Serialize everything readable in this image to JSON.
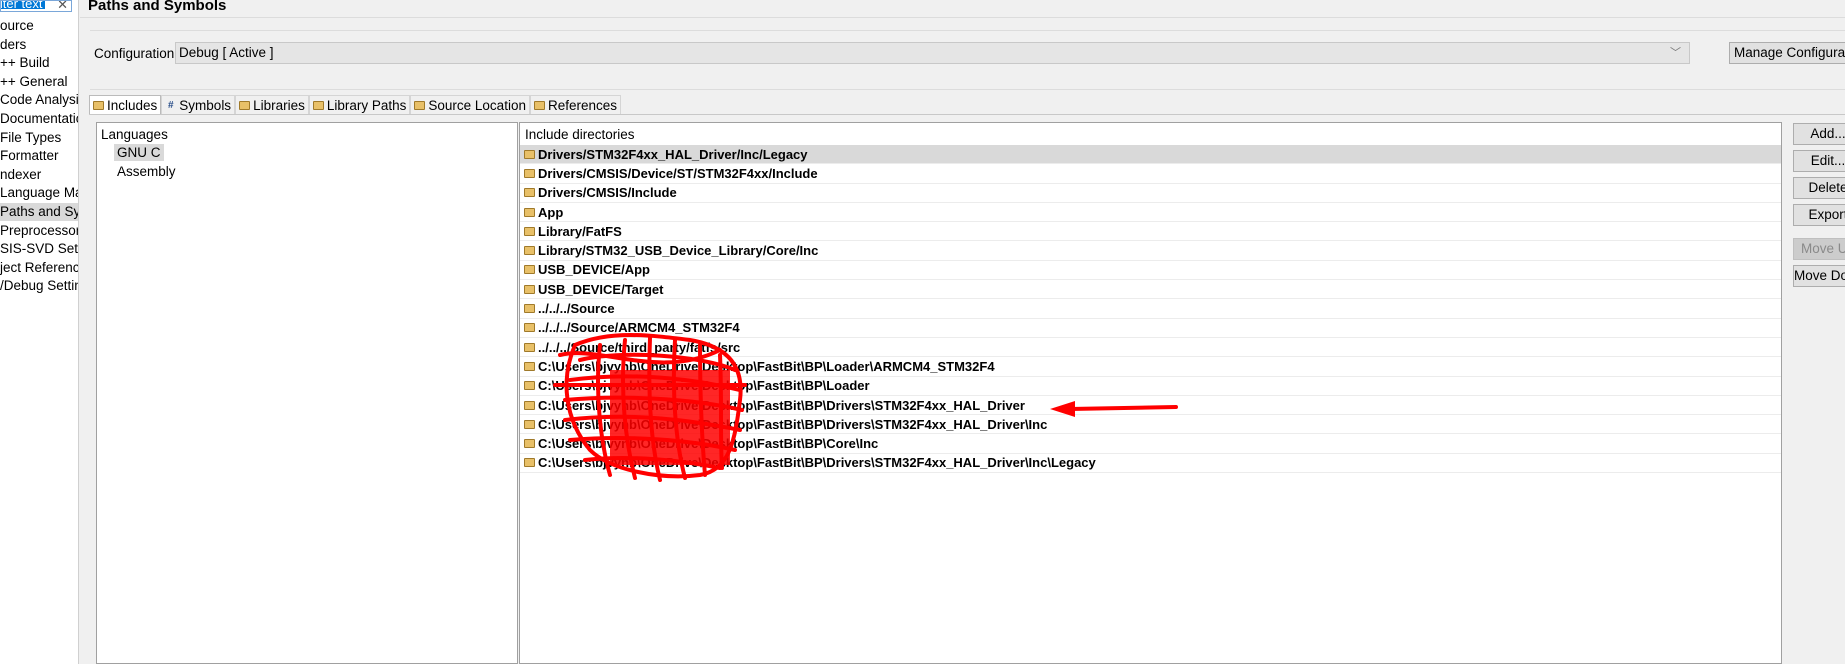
{
  "sidebar": {
    "filter_placeholder": "ilter text",
    "clear_icon": "✕",
    "items": [
      "ource",
      "ders",
      "++ Build",
      "++ General",
      "Code Analysis",
      "Documentatio",
      "File Types",
      "Formatter",
      "ndexer",
      "Language Map",
      "Paths and Sym",
      "Preprocessor I",
      "SIS-SVD Settin",
      "ject Reference:",
      "/Debug Settin"
    ],
    "active_index": 10
  },
  "page": {
    "title": "Paths and Symbols"
  },
  "configuration": {
    "label": "Configuration:",
    "value": "Debug  [ Active ]",
    "manage_label": "Manage Configurations..."
  },
  "tabs": [
    {
      "label": "Includes",
      "icon": "include-folder-icon"
    },
    {
      "label": "Symbols",
      "icon": "hash-icon",
      "glyph": "#"
    },
    {
      "label": "Libraries",
      "icon": "library-icon"
    },
    {
      "label": "Library Paths",
      "icon": "library-path-icon"
    },
    {
      "label": "Source Location",
      "icon": "source-folder-icon"
    },
    {
      "label": "References",
      "icon": "references-icon"
    }
  ],
  "languages": {
    "title": "Languages",
    "items": [
      "GNU C",
      "Assembly"
    ],
    "selected": "GNU C"
  },
  "includes": {
    "header": "Include directories",
    "rows": [
      "Drivers/STM32F4xx_HAL_Driver/Inc/Legacy",
      "Drivers/CMSIS/Device/ST/STM32F4xx/Include",
      "Drivers/CMSIS/Include",
      "App",
      "Library/FatFS",
      "Library/STM32_USB_Device_Library/Core/Inc",
      "USB_DEVICE/App",
      "USB_DEVICE/Target",
      "../../../Source",
      "../../../Source/ARMCM4_STM32F4",
      "../../../Source/third_party/fatfs/src",
      "C:\\Users\\bjvynb\\OneDrive\\Desktop\\FastBit\\BP\\Loader\\ARMCM4_STM32F4",
      "C:\\Users\\bjvynb\\OneDrive\\Desktop\\FastBit\\BP\\Loader",
      "C:\\Users\\bjvynb\\OneDrive\\Desktop\\FastBit\\BP\\Drivers\\STM32F4xx_HAL_Driver",
      "C:\\Users\\bjvynb\\OneDrive\\Desktop\\FastBit\\BP\\Drivers\\STM32F4xx_HAL_Driver\\Inc",
      "C:\\Users\\bjvynb\\OneDrive\\Desktop\\FastBit\\BP\\Core\\Inc",
      "C:\\Users\\bjvynb\\OneDrive\\Desktop\\FastBit\\BP\\Drivers\\STM32F4xx_HAL_Driver\\Inc\\Legacy"
    ],
    "selected_index": 0
  },
  "buttons": [
    {
      "label": "Add...",
      "enabled": true
    },
    {
      "label": "Edit...",
      "enabled": true
    },
    {
      "label": "Delete",
      "enabled": true
    },
    {
      "label": "Export",
      "enabled": true
    },
    {
      "label": "Move Up",
      "enabled": false
    },
    {
      "label": "Move Down",
      "enabled": true
    }
  ],
  "annotation": {
    "color": "#ff0000"
  }
}
